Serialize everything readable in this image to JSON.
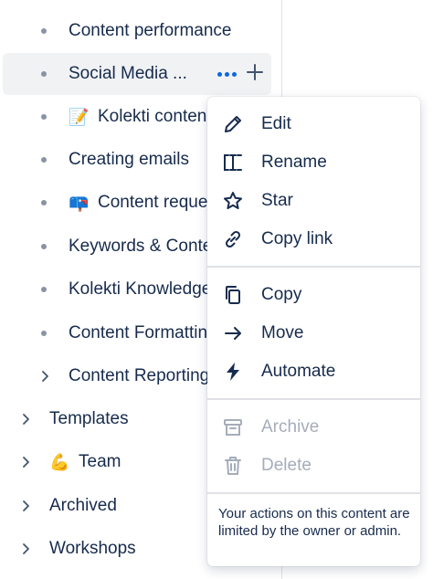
{
  "sidebar": {
    "items": [
      {
        "label": "Content performance",
        "marker": "bullet"
      },
      {
        "label": "Social Media ...",
        "marker": "bullet",
        "hovered": true
      },
      {
        "label": "Kolekti conten",
        "marker": "bullet",
        "emoji": "📝"
      },
      {
        "label": "Creating emails",
        "marker": "bullet"
      },
      {
        "label": "Content reque",
        "marker": "bullet",
        "emoji": "📪"
      },
      {
        "label": "Keywords & Conte",
        "marker": "bullet"
      },
      {
        "label": "Kolekti Knowledge",
        "marker": "bullet"
      },
      {
        "label": "Content Formattin",
        "marker": "bullet"
      },
      {
        "label": "Content Reporting",
        "marker": "chevron"
      },
      {
        "label": "Templates",
        "marker": "chevron"
      },
      {
        "label": "Team",
        "marker": "chevron",
        "emoji": "💪"
      },
      {
        "label": "Archived",
        "marker": "chevron"
      },
      {
        "label": "Workshops",
        "marker": "chevron"
      }
    ],
    "actions": {
      "more_icon": "more-horizontal-icon",
      "add_icon": "plus-icon"
    }
  },
  "menu": {
    "items": [
      {
        "label": "Edit",
        "icon": "pencil-icon",
        "disabled": false
      },
      {
        "label": "Rename",
        "icon": "rename-cursor-icon",
        "disabled": false
      },
      {
        "label": "Star",
        "icon": "star-icon",
        "disabled": false
      },
      {
        "label": "Copy link",
        "icon": "link-icon",
        "disabled": false
      },
      {
        "label": "Copy",
        "icon": "copy-icon",
        "disabled": false
      },
      {
        "label": "Move",
        "icon": "arrow-right-icon",
        "disabled": false
      },
      {
        "label": "Automate",
        "icon": "lightning-icon",
        "disabled": false
      },
      {
        "label": "Archive",
        "icon": "archive-icon",
        "disabled": true
      },
      {
        "label": "Delete",
        "icon": "trash-icon",
        "disabled": true
      }
    ],
    "note": "Your actions on this content are limited by the owner or admin."
  },
  "colors": {
    "text": "#172b4d",
    "disabled": "#a5adba",
    "accent": "#0c66e4",
    "hover_bg": "#f1f2f4"
  }
}
